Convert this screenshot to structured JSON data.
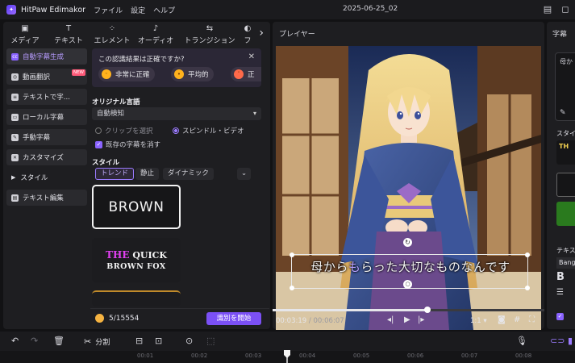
{
  "titlebar": {
    "app_name": "HitPaw Edimakor",
    "menu": [
      "ファイル",
      "設定",
      "ヘルプ"
    ],
    "document_title": "2025-06-25_02"
  },
  "tabs": [
    {
      "label": "メディア",
      "icon": "media-icon"
    },
    {
      "label": "テキスト",
      "icon": "text-icon"
    },
    {
      "label": "エレメント",
      "icon": "element-icon"
    },
    {
      "label": "オーディオ",
      "icon": "audio-icon"
    },
    {
      "label": "トランジション",
      "icon": "transition-icon"
    },
    {
      "label": "フ",
      "icon": "filter-icon"
    }
  ],
  "sidebar": {
    "items": [
      {
        "label": "自動字幕生成",
        "active": true
      },
      {
        "label": "動画翻訳",
        "badge": "NEW"
      },
      {
        "label": "テキストで字..."
      },
      {
        "label": "ローカル字幕"
      },
      {
        "label": "手動字幕"
      },
      {
        "label": "カスタマイズ"
      },
      {
        "label": "スタイル"
      },
      {
        "label": "テキスト編集"
      }
    ]
  },
  "feedback": {
    "question": "この認識結果は正確ですか?",
    "options": [
      "非常に正確",
      "平均的",
      "正"
    ]
  },
  "language": {
    "label": "オリジナル言語",
    "value": "自動検知"
  },
  "radio": {
    "clip": "クリップを選択",
    "spindle": "スピンドル・ビデオ"
  },
  "checkbox": {
    "replace": "既存の字幕を消す"
  },
  "style": {
    "label": "スタイル",
    "chips": [
      "トレンド",
      "静止",
      "ダイナミック"
    ],
    "card1": "BROWN",
    "card2_line1_the": "THE",
    "card2_line1_rest": "QUICK",
    "card2_line2": "BROWN FOX"
  },
  "bottom": {
    "credits": "5/15554",
    "start_button": "識別を開始"
  },
  "player": {
    "title": "プレイヤー",
    "subtitle_pre": "母から",
    "subtitle_hl": "も",
    "subtitle_post": "らった大切なものなんです",
    "current_time": "00:03:19",
    "duration": "/ 00:06:07",
    "ratio": "1:1",
    "progress": 0.57
  },
  "right_panel": {
    "title": "字幕",
    "box_text": "母か",
    "style_label": "スタイ",
    "text_label": "テキス",
    "font_value": "Bang",
    "bold_label": "B"
  },
  "timeline": {
    "split_label": "分割",
    "ticks": [
      "00:01",
      "00:02",
      "00:03",
      "00:04",
      "00:05",
      "00:06",
      "00:07",
      "00:08"
    ]
  },
  "colors": {
    "accent": "#8a63ff",
    "button": "#7b50f5",
    "panel": "#1e1e21"
  }
}
